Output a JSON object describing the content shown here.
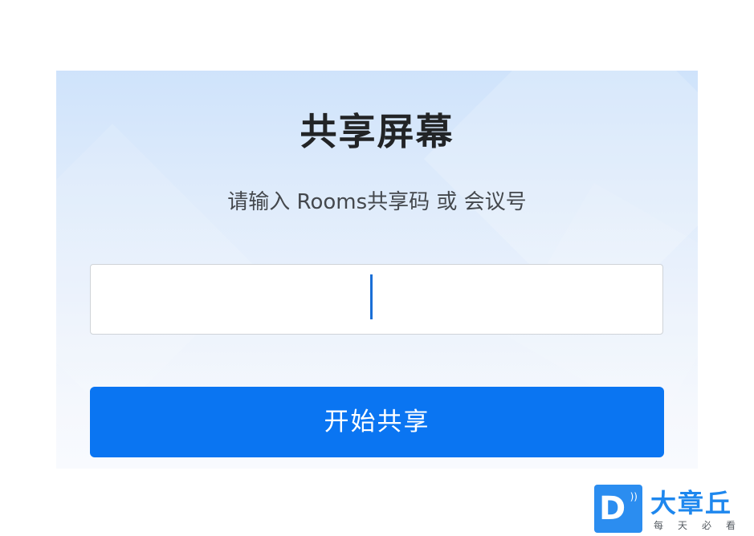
{
  "dialog": {
    "title": "共享屏幕",
    "subtitle": "请输入 Rooms共享码 或 会议号",
    "input": {
      "value": "",
      "placeholder": ""
    },
    "start_button_label": "开始共享"
  },
  "watermark": {
    "logo_letter": "D",
    "name": "大章丘",
    "tagline": "每天必看"
  },
  "colors": {
    "accent": "#0a75f2",
    "title_text": "#222426",
    "panel_top": "#cfe3fb",
    "watermark_blue": "#1e87ee"
  }
}
